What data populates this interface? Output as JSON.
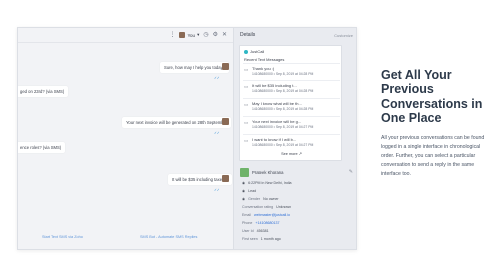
{
  "chat": {
    "toolbar": {
      "user_label": "You",
      "icons": [
        "kebab-icon",
        "chevron-down-icon",
        "clock-icon",
        "settings-icon",
        "close-icon"
      ]
    },
    "messages": [
      {
        "side": "right",
        "text": "Sure, how may I help you today?",
        "time": ""
      },
      {
        "side": "left",
        "text": "ged on 23rd? (via SMS)",
        "time": ""
      },
      {
        "side": "right",
        "text": "Your next invoice will be generated on 28th September",
        "time": ""
      },
      {
        "side": "left",
        "text": "ence roles? (via SMS)",
        "time": ""
      },
      {
        "side": "right",
        "text": "It will be $35 including taxes :)",
        "time": ""
      }
    ],
    "footer_links": [
      "Start Text SMS via Zoho",
      "SMS Bot - Automate SMS Replies"
    ]
  },
  "details": {
    "title": "Details",
    "customize": "Customize",
    "card": {
      "brand": "JustCall",
      "subtitle": "Recent Text Messages",
      "messages": [
        {
          "text": "Thank you :)",
          "meta": "14108680000 • Sep 8, 2019 at 04:28 PM"
        },
        {
          "text": "It will be $35 including t...",
          "meta": "14108680000 • Sep 8, 2019 at 04:28 PM"
        },
        {
          "text": "May I know what will be th...",
          "meta": "14108680000 • Sep 8, 2019 at 04:28 PM"
        },
        {
          "text": "Your next invoice will be g...",
          "meta": "14108680000 • Sep 8, 2019 at 04:27 PM"
        },
        {
          "text": "I want to know if I will b...",
          "meta": "14108680000 • Sep 8, 2019 at 04:27 PM"
        }
      ],
      "see_more": "See more ↗"
    },
    "contact": {
      "name": "Prateek Khorana",
      "rows": [
        {
          "k": "",
          "v": "6:22PM in New Delhi, India"
        },
        {
          "k": "",
          "v": "Lead"
        },
        {
          "k": "Gender",
          "v": "No owner"
        },
        {
          "k": "Conversation rating",
          "v": "Unknown"
        },
        {
          "k": "Email",
          "v": "webmaster@justcall.io"
        },
        {
          "k": "Phone",
          "v": "+14108680137"
        },
        {
          "k": "User Id",
          "v": "456381"
        },
        {
          "k": "First seen",
          "v": "1 month ago"
        }
      ]
    }
  },
  "marketing": {
    "headline": "Get All Your Previous Conversations in One Place",
    "body": "All your previous conversations can be found logged in a single interface in chronological order. Further, you can select a particular conversation to send a reply in the same interface too."
  },
  "colors": {
    "accent": "#2eb7c4",
    "headline": "#2d3a4a",
    "link": "#2f6fd6"
  }
}
